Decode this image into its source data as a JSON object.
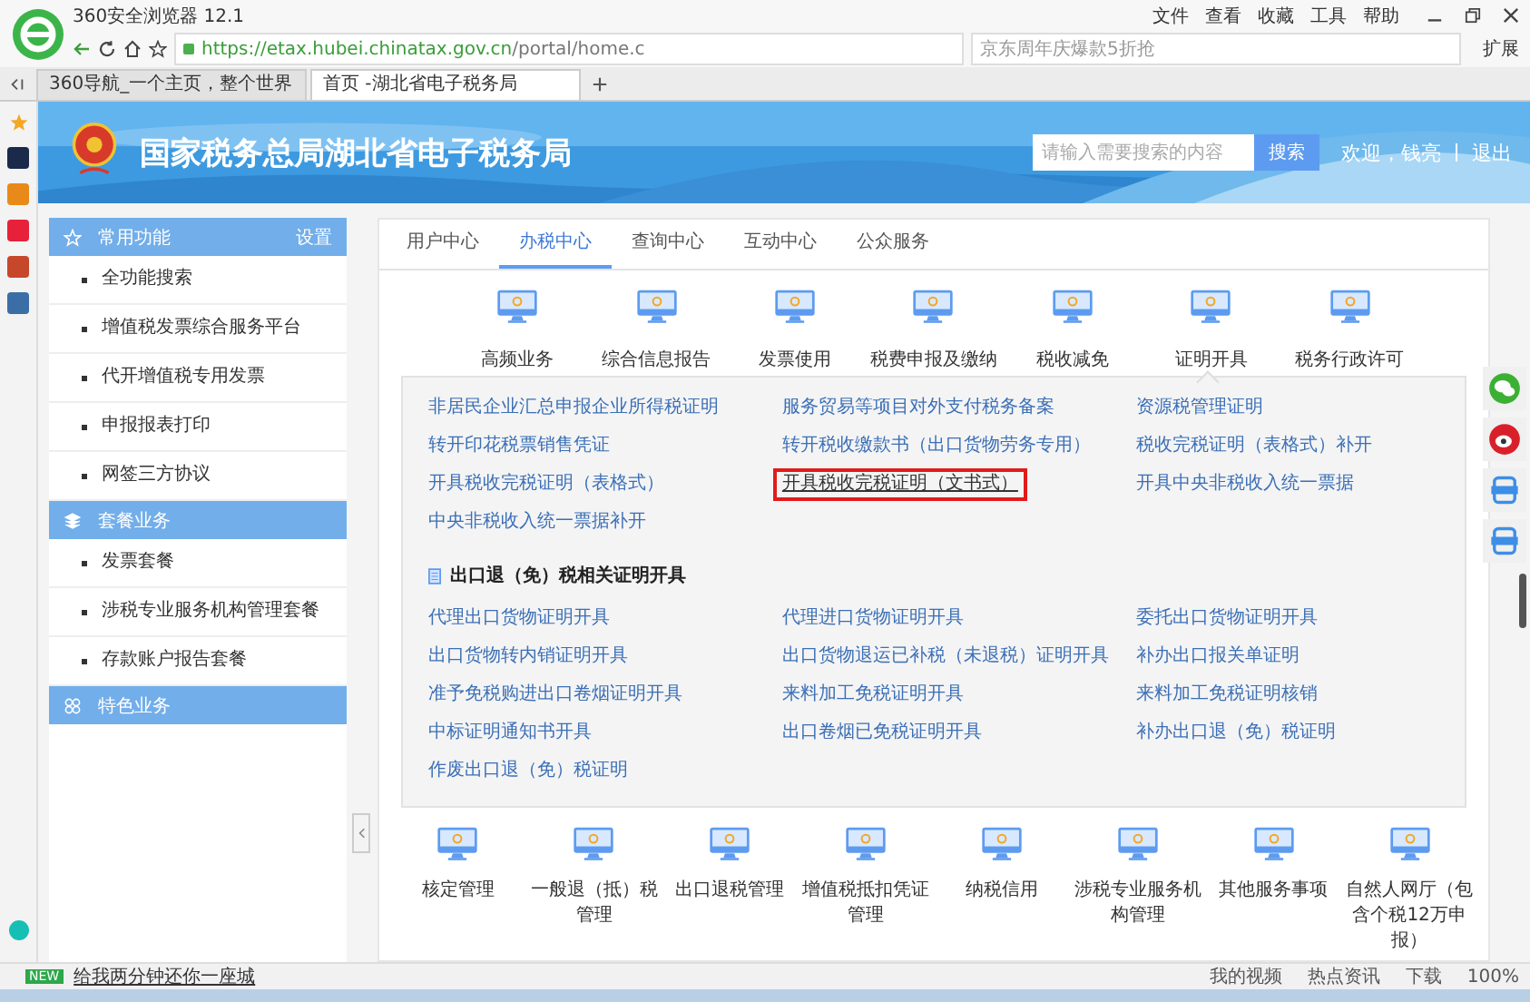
{
  "browser": {
    "title": "360安全浏览器 12.1",
    "menu": [
      "文件",
      "查看",
      "收藏",
      "工具",
      "帮助"
    ],
    "url_host": "https://etax.hubei.chinatax.gov.cn",
    "url_path": "/portal/home.c",
    "search_placeholder": "京东周年庆爆款5折抢",
    "extensions": "扩展",
    "tabs": [
      {
        "label": "360导航_一个主页，整个世界",
        "selected": false
      },
      {
        "label": "首页 -湖北省电子税务局",
        "selected": true
      }
    ]
  },
  "header": {
    "title": "国家税务总局湖北省电子税务局",
    "search_placeholder": "请输入需要搜索的内容",
    "search_button": "搜索",
    "welcome": "欢迎，钱亮",
    "logout": "退出"
  },
  "sidebar": [
    {
      "title": "常用功能",
      "kind": "star",
      "action": "设置",
      "items": [
        "全功能搜索",
        "增值税发票综合服务平台",
        "代开增值税专用发票",
        "申报报表打印",
        "网签三方协议"
      ]
    },
    {
      "title": "套餐业务",
      "kind": "stack",
      "items": [
        "发票套餐",
        "涉税专业服务机构管理套餐",
        "存款账户报告套餐"
      ]
    },
    {
      "title": "特色业务",
      "kind": "grid"
    }
  ],
  "tabs": [
    {
      "label": "用户中心",
      "selected": false
    },
    {
      "label": "办税中心",
      "selected": true
    },
    {
      "label": "查询中心",
      "selected": false
    },
    {
      "label": "互动中心",
      "selected": false
    },
    {
      "label": "公众服务",
      "selected": false
    }
  ],
  "services": [
    {
      "label": "高频业务",
      "expanded": false
    },
    {
      "label": "综合信息报告",
      "expanded": false
    },
    {
      "label": "发票使用",
      "expanded": false
    },
    {
      "label": "税费申报及缴纳",
      "expanded": false
    },
    {
      "label": "税收减免",
      "expanded": false
    },
    {
      "label": "证明开具",
      "expanded": true
    },
    {
      "label": "税务行政许可",
      "expanded": false
    }
  ],
  "links": [
    {
      "label": "非居民企业汇总申报企业所得税证明",
      "highlighted": false
    },
    {
      "label": "服务贸易等项目对外支付税务备案",
      "highlighted": false
    },
    {
      "label": "资源税管理证明",
      "highlighted": false
    },
    {
      "label": "转开印花税票销售凭证",
      "highlighted": false
    },
    {
      "label": "转开税收缴款书（出口货物劳务专用）",
      "highlighted": false
    },
    {
      "label": "税收完税证明（表格式）补开",
      "highlighted": false
    },
    {
      "label": "开具税收完税证明（表格式）",
      "highlighted": false
    },
    {
      "label": "开具税收完税证明（文书式）",
      "highlighted": true
    },
    {
      "label": "开具中央非税收入统一票据",
      "highlighted": false
    },
    {
      "label": "中央非税收入统一票据补开",
      "highlighted": false
    }
  ],
  "export_section": {
    "title": "出口退（免）税相关证明开具",
    "links": [
      "代理出口货物证明开具",
      "代理进口货物证明开具",
      "委托出口货物证明开具",
      "出口货物转内销证明开具",
      "出口货物退运已补税（未退税）证明开具",
      "补办出口报关单证明",
      "准予免税购进出口卷烟证明开具",
      "来料加工免税证明开具",
      "来料加工免税证明核销",
      "中标证明通知书开具",
      "出口卷烟已免税证明开具",
      "补办出口退（免）税证明",
      "作废出口退（免）税证明"
    ]
  },
  "bottom_services": [
    "核定管理",
    "一般退（抵）税管理",
    "出口退税管理",
    "增值税抵扣凭证管理",
    "纳税信用",
    "涉税专业服务机构管理",
    "其他服务事项",
    "自然人网厅（包含个税12万申报）"
  ],
  "status_bar": {
    "badge": "NEW",
    "news": "给我两分钟还你一座城",
    "items": [
      "我的视频",
      "热点资讯",
      "下载"
    ],
    "zoom": "100%"
  }
}
